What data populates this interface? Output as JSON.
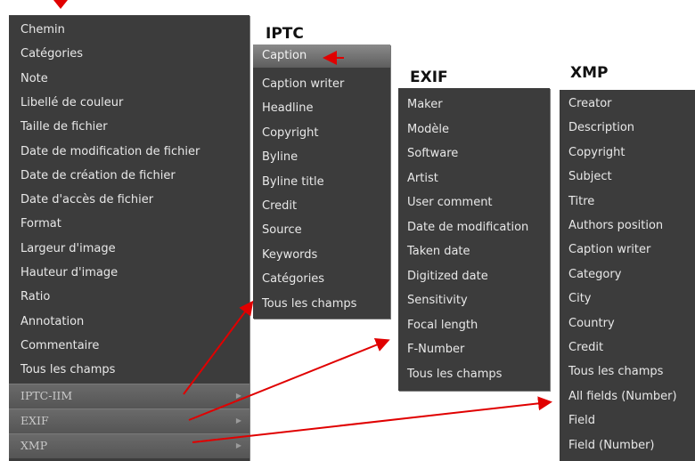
{
  "main_menu": {
    "items": [
      "Chemin",
      "Catégories",
      "Note",
      "Libellé de couleur",
      "Taille de fichier",
      "Date de modification de fichier",
      "Date de création de fichier",
      "Date d'accès de fichier",
      "Format",
      "Largeur d'image",
      "Hauteur d'image",
      "Ratio",
      "Annotation",
      "Commentaire",
      "Tous les champs"
    ],
    "submenus": [
      "IPTC-IIM",
      "EXIF",
      "XMP"
    ]
  },
  "iptc": {
    "title": "IPTC",
    "items": [
      "Caption",
      "Caption writer",
      "Headline",
      "Copyright",
      "Byline",
      "Byline title",
      "Credit",
      "Source",
      "Keywords",
      "Catégories",
      "Tous les champs"
    ]
  },
  "exif": {
    "title": "EXIF",
    "items": [
      "Maker",
      "Modèle",
      "Software",
      "Artist",
      "User comment",
      "Date de modification",
      "Taken date",
      "Digitized date",
      "Sensitivity",
      "Focal length",
      "F-Number",
      "Tous les champs"
    ]
  },
  "xmp": {
    "title": "XMP",
    "items": [
      "Creator",
      "Description",
      "Copyright",
      "Subject",
      "Titre",
      "Authors position",
      "Caption writer",
      "Category",
      "City",
      "Country",
      "Credit",
      "Tous les champs",
      "All fields (Number)",
      "Field",
      "Field (Number)"
    ]
  },
  "colors": {
    "menu_bg": "#3c3c3c",
    "arrow": "#e00000"
  }
}
